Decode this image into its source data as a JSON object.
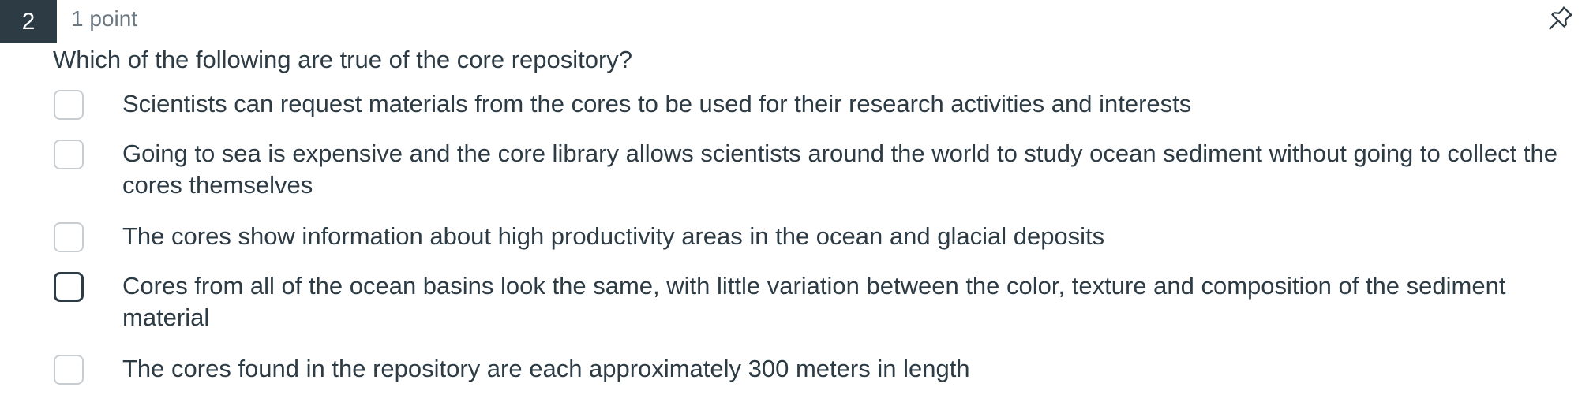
{
  "question": {
    "number": "2",
    "points": "1 point",
    "prompt": "Which of the following are true of the core repository?",
    "pin_icon": "pin-icon"
  },
  "options": [
    {
      "label": "Scientists can request materials from the cores to be used for their research activities and interests",
      "checked": false
    },
    {
      "label": "Going to sea is expensive and the core library allows scientists around the world to study ocean sediment without going to collect the cores themselves",
      "checked": false
    },
    {
      "label": "The cores show information about high productivity areas in the ocean and glacial deposits",
      "checked": false
    },
    {
      "label": "Cores from all of the ocean basins look the same, with little variation between the color, texture and composition of the sediment material",
      "checked": false
    },
    {
      "label": "The cores found in the repository are each approximately 300 meters in length",
      "checked": false
    }
  ],
  "colors": {
    "header_bg": "#2d3b45",
    "text": "#2d3b45",
    "muted": "#6b7780",
    "checkbox_border": "#c7cdd1"
  }
}
